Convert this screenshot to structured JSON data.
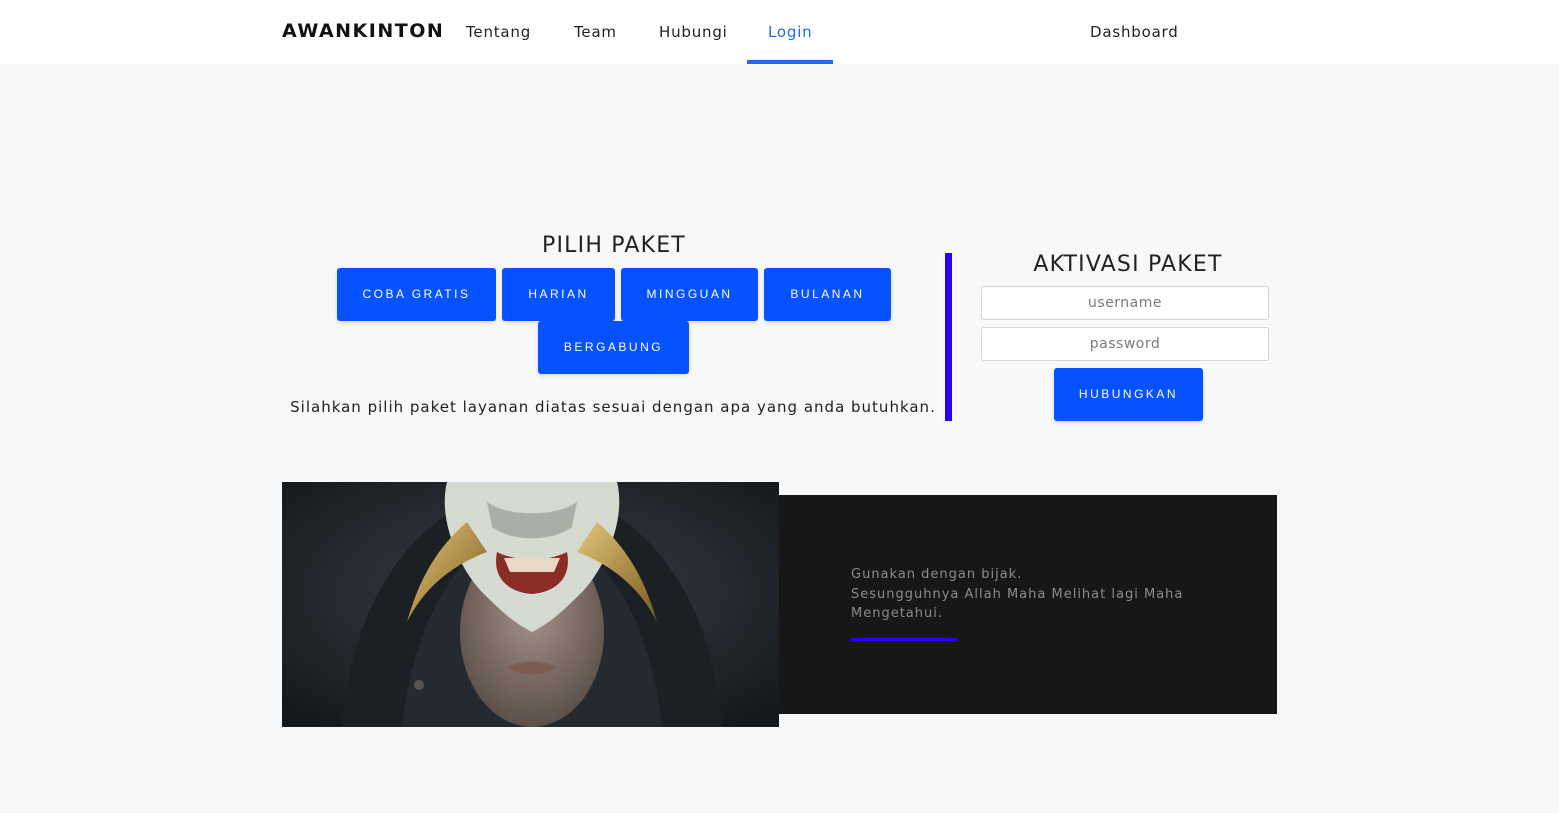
{
  "nav": {
    "brand": "AWANKINTON",
    "links": [
      {
        "label": "Tentang"
      },
      {
        "label": "Team"
      },
      {
        "label": "Hubungi"
      },
      {
        "label": "Login"
      }
    ],
    "active": "Login",
    "dashboard": "Dashboard",
    "accent_color": "#1e6fe6"
  },
  "pilih_paket": {
    "title": "PILIH PAKET",
    "buttons": [
      "COBA GRATIS",
      "HARIAN",
      "MINGGUAN",
      "BULANAN",
      "BERGABUNG"
    ],
    "description": "Silahkan pilih paket layanan diatas sesuai dengan apa yang anda butuhkan.",
    "button_color": "#0652ff"
  },
  "aktivasi": {
    "title": "AKTIVASI PAKET",
    "username_placeholder": "username",
    "password_placeholder": "password",
    "submit_label": "HUBUNGKAN",
    "divider_color": "#2a00f0"
  },
  "quote": {
    "line1": "Gunakan dengan bijak.",
    "line2": "Sesungguhnya Allah Maha Melihat lagi Maha",
    "line3": "Mengetahui."
  },
  "image": {
    "icon": "oni-mask-hooded-figure-photo"
  }
}
